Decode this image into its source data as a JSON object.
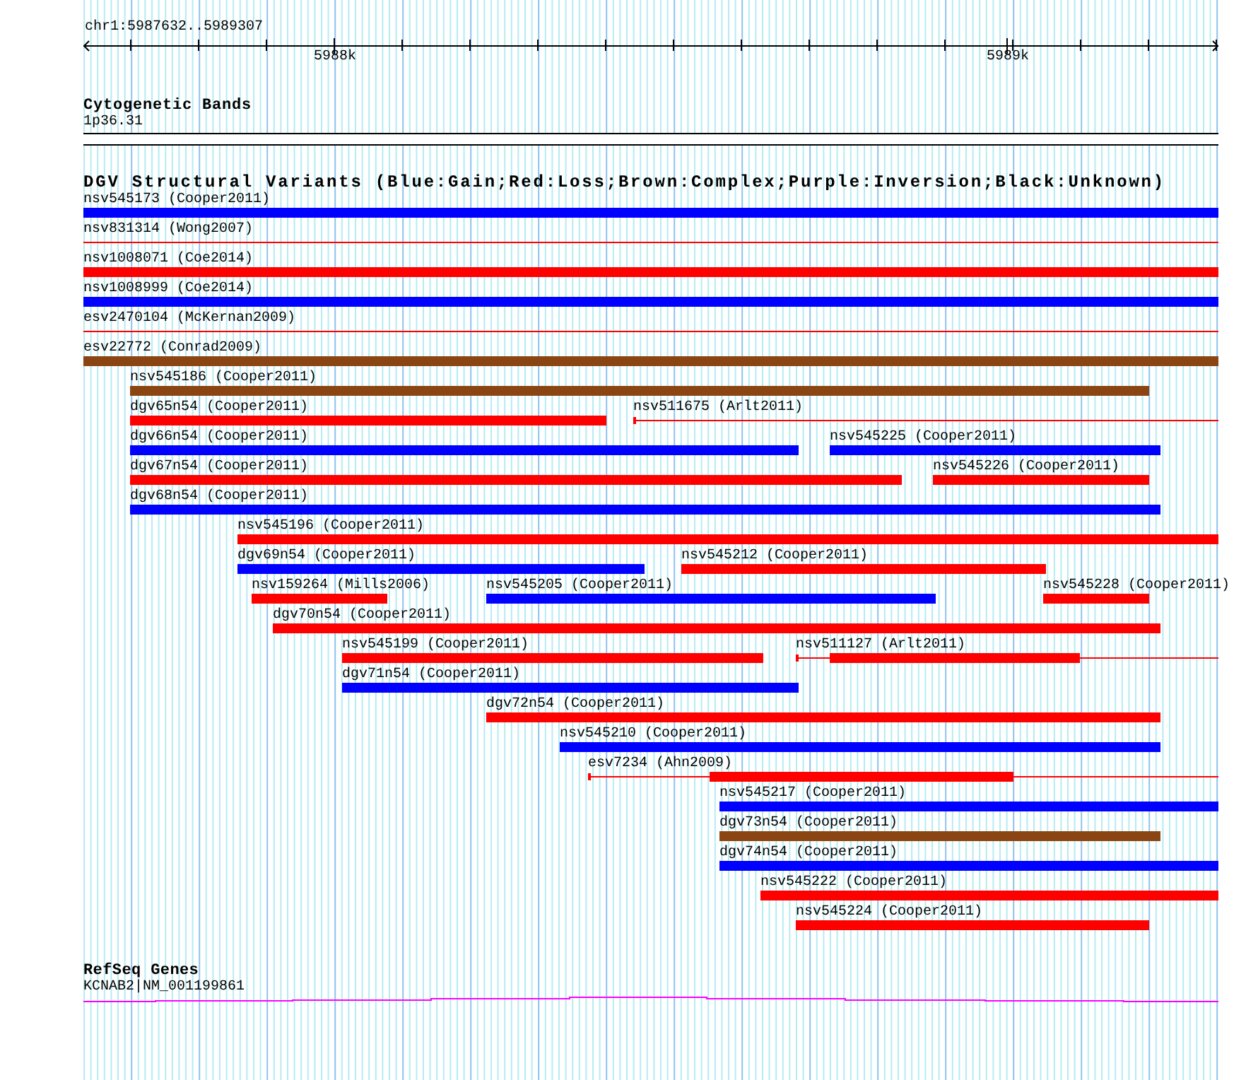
{
  "ruler": {
    "range": "chr1:5987632..5989307",
    "ticks": [
      "5988k",
      "5989k"
    ]
  },
  "cytogenetic_bands": {
    "title": "Cytogenetic Bands",
    "band": "1p36.31"
  },
  "structural_variants": {
    "title": "DGV Structural Variants (Blue:Gain;Red:Loss;Brown:Complex;Purple:Inversion;Black:Unknown)",
    "rows": [
      {
        "features": [
          {
            "label": "nsv545173 (Cooper2011)",
            "color": "#0000ff",
            "kind": "bar"
          }
        ]
      },
      {
        "features": [
          {
            "label": "nsv831314 (Wong2007)",
            "color": "#ff0000",
            "kind": "line"
          }
        ]
      },
      {
        "features": [
          {
            "label": "nsv1008071 (Coe2014)",
            "color": "#ff0000",
            "kind": "bar"
          }
        ]
      },
      {
        "features": [
          {
            "label": "nsv1008999 (Coe2014)",
            "color": "#0000ff",
            "kind": "bar"
          }
        ]
      },
      {
        "features": [
          {
            "label": "esv2470104 (McKernan2009)",
            "color": "#ff0000",
            "kind": "line"
          }
        ]
      },
      {
        "features": [
          {
            "label": "esv22772 (Conrad2009)",
            "color": "#8b4513",
            "kind": "bar"
          }
        ]
      },
      {
        "features": [
          {
            "label": "nsv545186 (Cooper2011)",
            "color": "#8b4513",
            "kind": "bar"
          }
        ]
      },
      {
        "features": [
          {
            "label": "dgv65n54 (Cooper2011)",
            "color": "#ff0000",
            "kind": "bar"
          },
          {
            "label": "nsv511675 (Arlt2011)",
            "color": "#ff0000",
            "kind": "split"
          }
        ]
      },
      {
        "features": [
          {
            "label": "dgv66n54 (Cooper2011)",
            "color": "#0000ff",
            "kind": "bar"
          },
          {
            "label": "nsv545225 (Cooper2011)",
            "color": "#0000ff",
            "kind": "bar"
          }
        ]
      },
      {
        "features": [
          {
            "label": "dgv67n54 (Cooper2011)",
            "color": "#ff0000",
            "kind": "bar"
          },
          {
            "label": "nsv545226 (Cooper2011)",
            "color": "#ff0000",
            "kind": "bar"
          }
        ]
      },
      {
        "features": [
          {
            "label": "dgv68n54 (Cooper2011)",
            "color": "#0000ff",
            "kind": "bar"
          }
        ]
      },
      {
        "features": [
          {
            "label": "nsv545196 (Cooper2011)",
            "color": "#ff0000",
            "kind": "bar"
          }
        ]
      },
      {
        "features": [
          {
            "label": "dgv69n54 (Cooper2011)",
            "color": "#0000ff",
            "kind": "bar"
          },
          {
            "label": "nsv545212 (Cooper2011)",
            "color": "#ff0000",
            "kind": "bar"
          }
        ]
      },
      {
        "features": [
          {
            "label": "nsv159264 (Mills2006)",
            "color": "#ff0000",
            "kind": "bar"
          },
          {
            "label": "nsv545205 (Cooper2011)",
            "color": "#0000ff",
            "kind": "bar"
          },
          {
            "label": "nsv545228 (Cooper2011)",
            "color": "#ff0000",
            "kind": "bar"
          }
        ]
      },
      {
        "features": [
          {
            "label": "dgv70n54 (Cooper2011)",
            "color": "#ff0000",
            "kind": "bar"
          }
        ]
      },
      {
        "features": [
          {
            "label": "nsv545199 (Cooper2011)",
            "color": "#ff0000",
            "kind": "bar"
          },
          {
            "label": "nsv511127 (Arlt2011)",
            "color": "#ff0000",
            "kind": "split"
          }
        ]
      },
      {
        "features": [
          {
            "label": "dgv71n54 (Cooper2011)",
            "color": "#0000ff",
            "kind": "bar"
          }
        ]
      },
      {
        "features": [
          {
            "label": "dgv72n54 (Cooper2011)",
            "color": "#ff0000",
            "kind": "bar"
          }
        ]
      },
      {
        "features": [
          {
            "label": "nsv545210 (Cooper2011)",
            "color": "#0000ff",
            "kind": "bar"
          }
        ]
      },
      {
        "features": [
          {
            "label": "esv7234 (Ahn2009)",
            "color": "#ff0000",
            "kind": "split"
          }
        ]
      },
      {
        "features": [
          {
            "label": "nsv545217 (Cooper2011)",
            "color": "#0000ff",
            "kind": "bar"
          }
        ]
      },
      {
        "features": [
          {
            "label": "dgv73n54 (Cooper2011)",
            "color": "#8b4513",
            "kind": "bar"
          }
        ]
      },
      {
        "features": [
          {
            "label": "dgv74n54 (Cooper2011)",
            "color": "#0000ff",
            "kind": "bar"
          }
        ]
      },
      {
        "features": [
          {
            "label": "nsv545222 (Cooper2011)",
            "color": "#ff0000",
            "kind": "bar"
          }
        ]
      },
      {
        "features": [
          {
            "label": "nsv545224 (Cooper2011)",
            "color": "#ff0000",
            "kind": "bar"
          }
        ]
      }
    ]
  },
  "refseq_genes": {
    "title": "RefSeq Genes",
    "gene": "KCNAB2|NM_001199861"
  }
}
